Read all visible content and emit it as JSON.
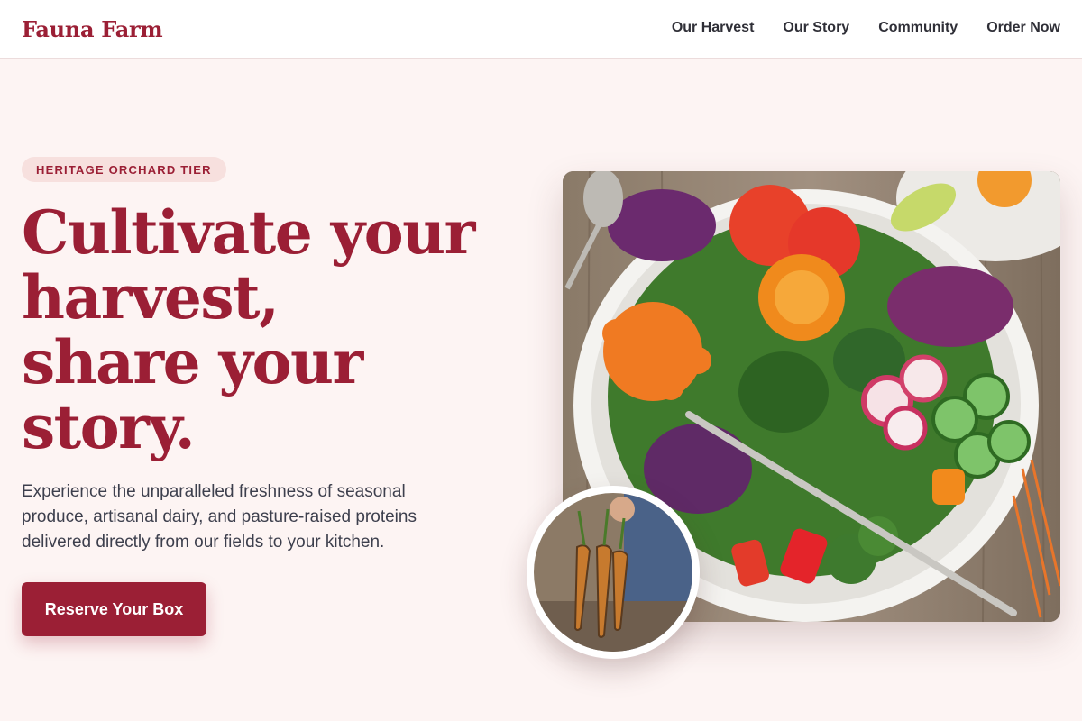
{
  "header": {
    "brand": "Fauna Farm",
    "nav": [
      "Our Harvest",
      "Our Story",
      "Community",
      "Order Now"
    ]
  },
  "hero": {
    "badge": "HERITAGE ORCHARD TIER",
    "headline_lines": [
      "Cultivate your",
      "harvest,",
      "share your",
      "story."
    ],
    "subcopy": "Experience the unparalleled freshness of seasonal produce, artisanal dairy, and pasture-raised proteins delivered directly from our fields to your kitchen.",
    "cta_label": "Reserve Your Box"
  },
  "colors": {
    "accent": "#9b1f35",
    "page_bg": "#fdf4f3",
    "badge_bg": "#f7e0de"
  },
  "images": {
    "main": "salad-bowl-photo",
    "inset": "harvested-carrots-photo"
  }
}
